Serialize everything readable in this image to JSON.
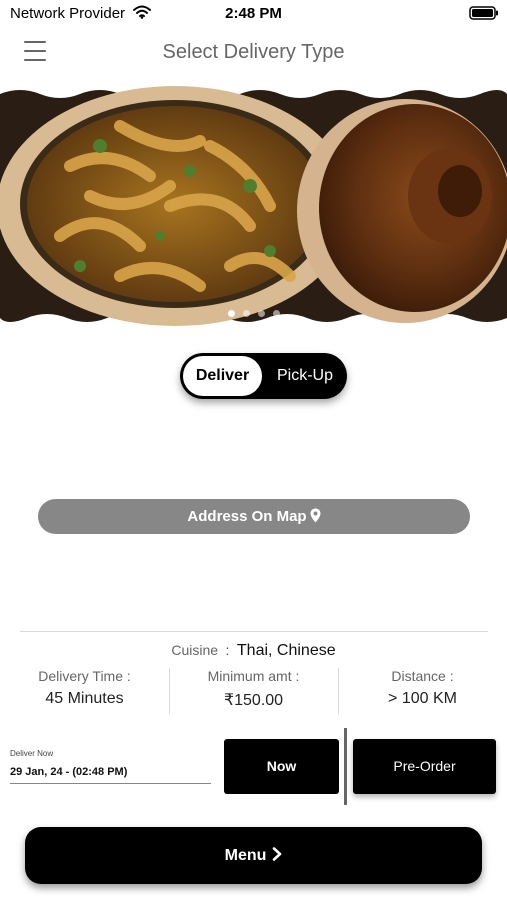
{
  "status_bar": {
    "carrier": "Network Provider",
    "time": "2:48 PM",
    "wifi_icon": "wifi-icon",
    "battery_icon": "battery-icon"
  },
  "header": {
    "menu_icon": "hamburger-menu-icon",
    "title": "Select Delivery Type"
  },
  "hero": {
    "image": "claypot-chicken-noodles-photo",
    "dots_count": 4,
    "active_dot": 0
  },
  "delivery_toggle": {
    "options": [
      "Deliver",
      "Pick-Up"
    ],
    "selected": "Deliver"
  },
  "address_button": {
    "label": "Address On Map",
    "icon": "map-pin-icon"
  },
  "cuisine": {
    "label": "Cuisine",
    "separator": ":",
    "value": "Thai, Chinese"
  },
  "stats": [
    {
      "label": "Delivery Time  :",
      "value": "45 Minutes"
    },
    {
      "label": "Minimum amt  :",
      "value": "₹150.00"
    },
    {
      "label": "Distance :",
      "value": "> 100 KM"
    }
  ],
  "schedule": {
    "caption": "Deliver Now",
    "datetime": "29 Jan, 24 - (02:48 PM)",
    "now_label": "Now",
    "preorder_label": "Pre-Order"
  },
  "footer": {
    "menu_label": "Menu",
    "menu_icon": "chevron-right-icon"
  },
  "colors": {
    "primary": "#000000",
    "address_button": "#878787",
    "title_gray": "#666666"
  }
}
